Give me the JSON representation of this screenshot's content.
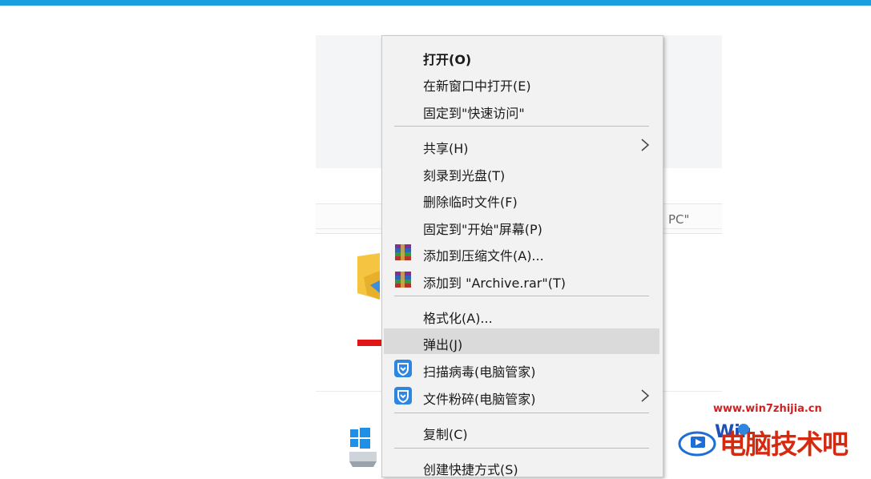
{
  "explorer": {
    "address_suffix": "PC\""
  },
  "context_menu": {
    "items": [
      {
        "label": "打开(O)"
      },
      {
        "label": "在新窗口中打开(E)"
      },
      {
        "label": "固定到\"快速访问\""
      },
      {
        "label": "共享(H)"
      },
      {
        "label": "刻录到光盘(T)"
      },
      {
        "label": "删除临时文件(F)"
      },
      {
        "label": "固定到\"开始\"屏幕(P)"
      },
      {
        "label": "添加到压缩文件(A)...",
        "icon": "winrar-icon"
      },
      {
        "label": "添加到 \"Archive.rar\"(T)",
        "icon": "winrar-icon"
      },
      {
        "label": "格式化(A)..."
      },
      {
        "label": "弹出(J)"
      },
      {
        "label": "扫描病毒(电脑管家)",
        "icon": "tencent-shield-icon"
      },
      {
        "label": "文件粉碎(电脑管家)",
        "icon": "tencent-shield-icon"
      },
      {
        "label": "复制(C)"
      },
      {
        "label": "创建快捷方式(S)"
      }
    ],
    "highlighted_item": "弹出(J)"
  },
  "watermark": {
    "url": "www.win7zhijia.cn",
    "name": "电脑技术吧"
  },
  "colors": {
    "top_bar": "#1aa0e0",
    "menu_bg": "#f2f2f2",
    "highlight": "#dadada",
    "arrow": "#e01515",
    "watermark": "#d42b10"
  }
}
